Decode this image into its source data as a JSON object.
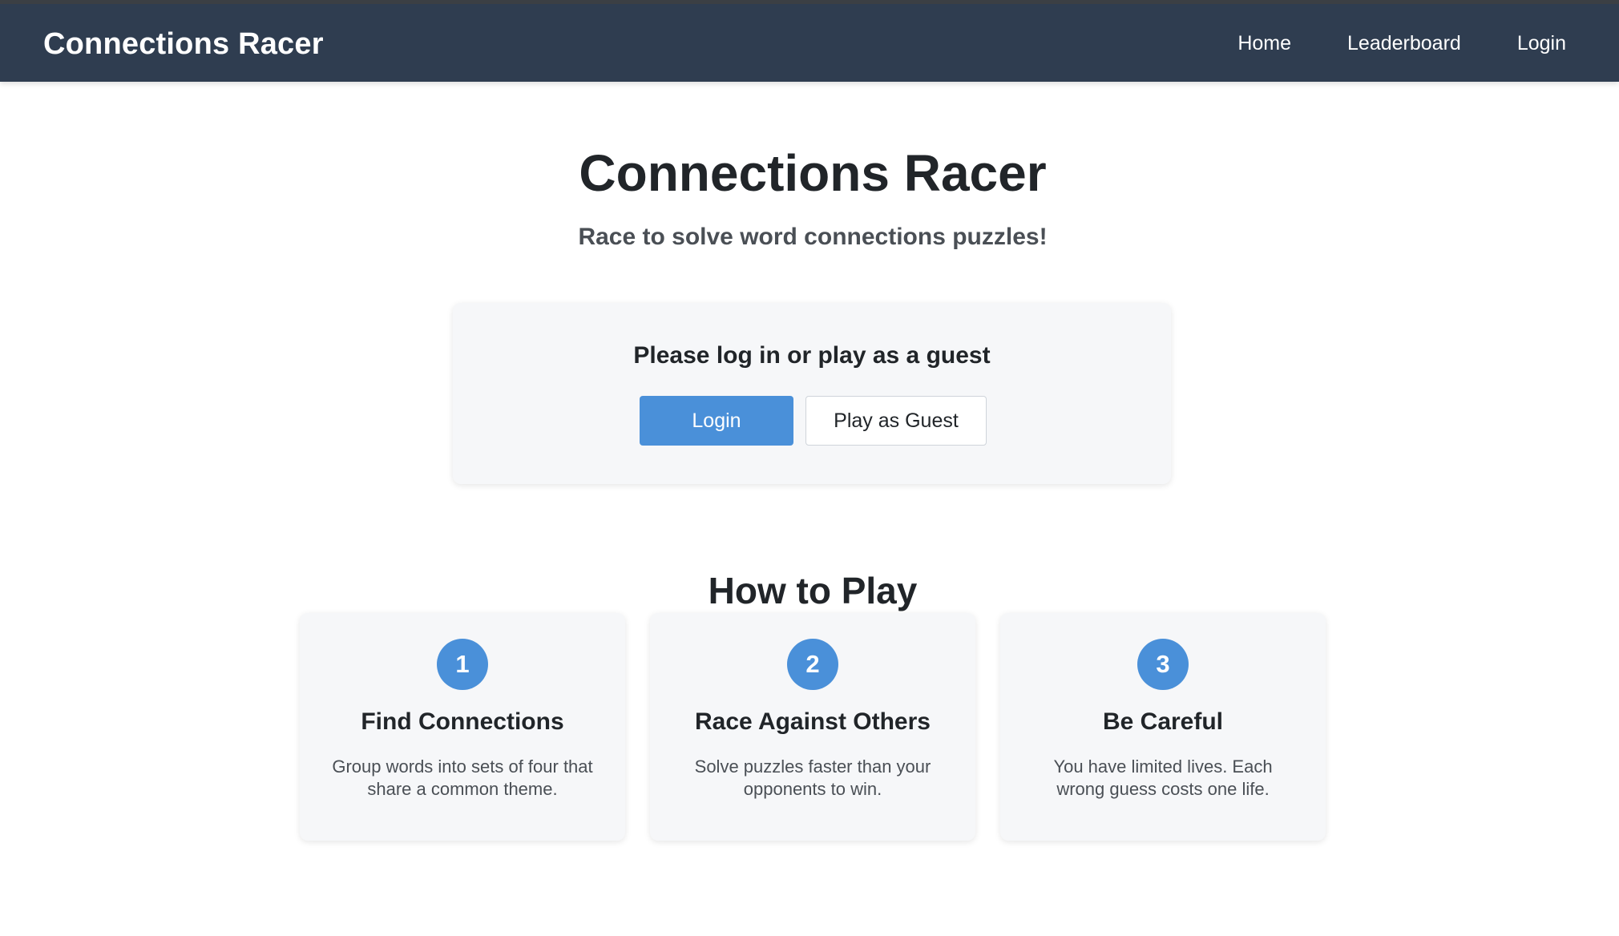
{
  "navbar": {
    "brand": "Connections Racer",
    "links": [
      {
        "label": "Home"
      },
      {
        "label": "Leaderboard"
      },
      {
        "label": "Login"
      }
    ]
  },
  "hero": {
    "title": "Connections Racer",
    "subtitle": "Race to solve word connections puzzles!"
  },
  "auth": {
    "prompt": "Please log in or play as a guest",
    "login_label": "Login",
    "guest_label": "Play as Guest"
  },
  "how_to_play": {
    "title": "How to Play",
    "steps": [
      {
        "number": "1",
        "title": "Find Connections",
        "description": "Group words into sets of four that share a common theme."
      },
      {
        "number": "2",
        "title": "Race Against Others",
        "description": "Solve puzzles faster than your opponents to win."
      },
      {
        "number": "3",
        "title": "Be Careful",
        "description": "You have limited lives. Each wrong guess costs one life."
      }
    ]
  },
  "colors": {
    "navbar": "#2f3d50",
    "accent": "#4a90d9",
    "card": "#f6f7f9"
  }
}
